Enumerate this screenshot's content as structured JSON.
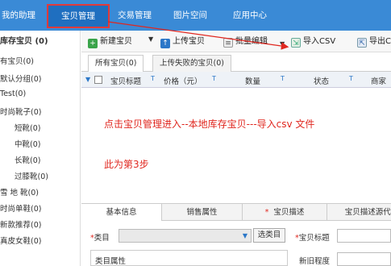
{
  "topnav": {
    "items": [
      {
        "label": "我的助理"
      },
      {
        "label": "宝贝管理"
      },
      {
        "label": "交易管理"
      },
      {
        "label": "图片空间"
      },
      {
        "label": "应用中心"
      }
    ]
  },
  "sidebar": {
    "title": "库存宝贝 (0)",
    "items": [
      {
        "label": "有宝贝(0)"
      },
      {
        "label": "默认分组(0)"
      },
      {
        "label": "Test(0)"
      },
      {
        "label": "时尚靴子(0)"
      },
      {
        "label": "短靴(0)"
      },
      {
        "label": "中靴(0)"
      },
      {
        "label": "长靴(0)"
      },
      {
        "label": "过膝靴(0)"
      },
      {
        "label": "雪 地 靴(0)"
      },
      {
        "label": "时尚单鞋(0)"
      },
      {
        "label": "新款推荐(0)"
      },
      {
        "label": "真皮女鞋(0)"
      }
    ]
  },
  "toolbar": {
    "new_label": "新建宝贝",
    "upload_label": "上传宝贝",
    "batch_label": "批量编辑",
    "import_label": "导入CSV",
    "export_label": "导出CSV"
  },
  "tabs": [
    {
      "label": "所有宝贝(0)"
    },
    {
      "label": "上传失败的宝贝(0)"
    }
  ],
  "table": {
    "headers": {
      "title": "宝贝标题",
      "price": "价格（元）",
      "qty": "数量",
      "status": "状态",
      "merchant": "商家"
    }
  },
  "annotations": {
    "line1": "点击宝贝管理进入--本地库存宝贝---导入csv 文件",
    "line2": "此为第3步"
  },
  "detail_tabs": [
    {
      "label": "基本信息"
    },
    {
      "label": "销售属性"
    },
    {
      "label": "宝贝描述",
      "required": "*"
    },
    {
      "label": "宝贝描述源代码"
    }
  ],
  "form": {
    "category_label": "类目",
    "category_required": "*",
    "pick_button": "选类目",
    "title_label": "宝贝标题",
    "title_required": "*",
    "attr_label": "类目属性",
    "newness_label": "新旧程度"
  },
  "colors": {
    "nav_bg": "#3a8ad6",
    "nav_active": "#1f6fc0",
    "highlight": "#e23a3a",
    "annotation": "#e0271f"
  }
}
